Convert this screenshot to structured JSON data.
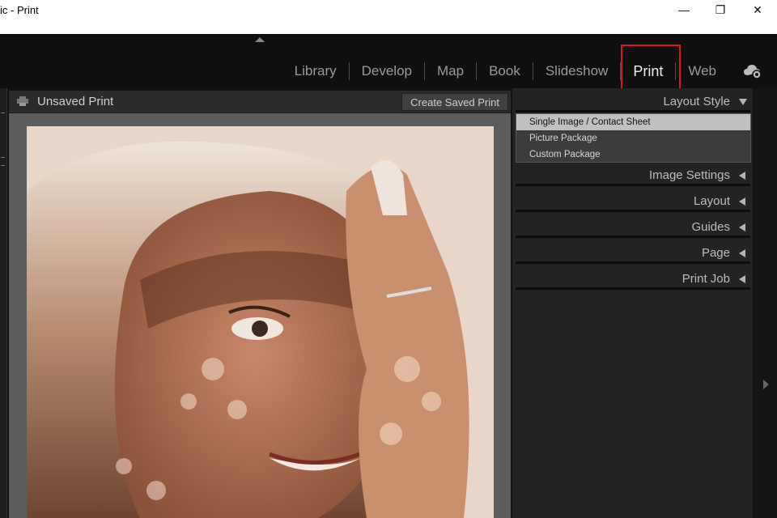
{
  "window": {
    "title": "ic - Print",
    "minimize_glyph": "—",
    "restore_glyph": "❐",
    "close_glyph": "✕"
  },
  "modules": [
    {
      "label": "Library",
      "active": false
    },
    {
      "label": "Develop",
      "active": false
    },
    {
      "label": "Map",
      "active": false
    },
    {
      "label": "Book",
      "active": false
    },
    {
      "label": "Slideshow",
      "active": false
    },
    {
      "label": "Print",
      "active": true
    },
    {
      "label": "Web",
      "active": false
    }
  ],
  "toolbar": {
    "doc_title": "Unsaved Print",
    "create_saved_print": "Create Saved Print"
  },
  "right_panel": {
    "layout_style": {
      "label": "Layout Style",
      "options": [
        {
          "label": "Single Image / Contact Sheet",
          "selected": true
        },
        {
          "label": "Picture Package",
          "selected": false
        },
        {
          "label": "Custom Package",
          "selected": false
        }
      ]
    },
    "sections": [
      {
        "label": "Image Settings"
      },
      {
        "label": "Layout"
      },
      {
        "label": "Guides"
      },
      {
        "label": "Page"
      },
      {
        "label": "Print Job"
      }
    ]
  },
  "colors": {
    "highlight": "#e0141e",
    "active_module": "#ededed",
    "inactive_module": "#9a9a9a"
  }
}
